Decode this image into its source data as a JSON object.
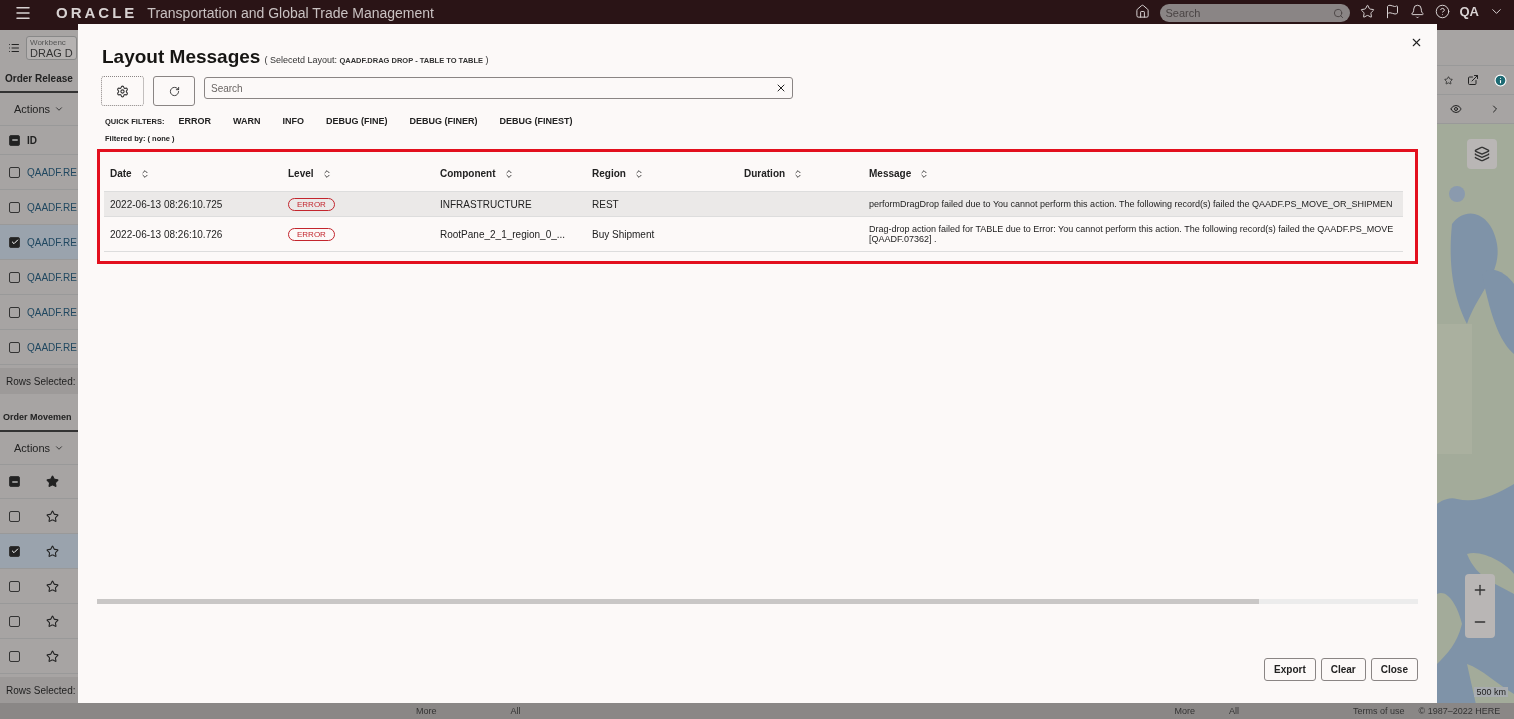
{
  "app_header": {
    "logo": "ORACLE",
    "title": "Transportation and Global Trade Management",
    "search": {
      "placeholder": "Search"
    },
    "user": "QA"
  },
  "left_panel": {
    "workbench": {
      "label": "Workbenc",
      "value": "DRAG D"
    },
    "order_release": {
      "tab": "Order Release",
      "actions": "Actions",
      "column": "ID",
      "select_all_partial": true,
      "rows": [
        {
          "id": "QAADF.RE",
          "checked": false
        },
        {
          "id": "QAADF.RE",
          "checked": false
        },
        {
          "id": "QAADF.RE",
          "checked": true
        },
        {
          "id": "QAADF.RE",
          "checked": false
        },
        {
          "id": "QAADF.RE",
          "checked": false
        },
        {
          "id": "QAADF.RE",
          "checked": false
        }
      ],
      "rows_selected": "Rows Selected:"
    },
    "order_movement": {
      "tab": "Order Movemen",
      "actions": "Actions",
      "select_all_partial": true,
      "header_starred": true,
      "rows": [
        {
          "checked": false,
          "starred": false
        },
        {
          "checked": true,
          "starred": false
        },
        {
          "checked": false,
          "starred": false
        },
        {
          "checked": false,
          "starred": false
        },
        {
          "checked": false,
          "starred": false
        }
      ],
      "rows_selected": "Rows Selected:"
    }
  },
  "map_panel": {
    "scale": "500 km",
    "copyright": "© 1987–2022 HERE",
    "terms": "Terms of use"
  },
  "footer_links": [
    "More",
    "All",
    "More",
    "All"
  ],
  "dialog": {
    "title": "Layout Messages",
    "subtitle_prefix": "( Selecetd Layout: ",
    "layout_name": "QAADF.DRAG DROP - TABLE TO TABLE",
    "subtitle_suffix": " )",
    "search": {
      "placeholder": "Search"
    },
    "quick_filters_label": "QUICK FILTERS:",
    "quick_filters": [
      "ERROR",
      "WARN",
      "INFO",
      "DEBUG (FINE)",
      "DEBUG (FINER)",
      "DEBUG (FINEST)"
    ],
    "filtered_by": "Filtered by: ( none )",
    "table": {
      "columns": [
        "Date",
        "Level",
        "Component",
        "Region",
        "Duration",
        "Message"
      ],
      "rows": [
        {
          "date": "2022-06-13 08:26:10.725",
          "level": "ERROR",
          "component": "INFRASTRUCTURE",
          "region": "REST",
          "message_lines": [
            "performDragDrop failed due to You cannot perform this action. The following record(s) failed the QAADF.PS_MOVE_OR_SHIPMEN"
          ],
          "selected": true
        },
        {
          "date": "2022-06-13 08:26:10.726",
          "level": "ERROR",
          "component": "RootPane_2_1_region_0_...",
          "region": "Buy Shipment",
          "message_lines": [
            "Drag-drop action failed for TABLE due to Error: You cannot perform this action. The following record(s) failed the QAADF.PS_MOVE",
            "[QAADF.07362] ."
          ],
          "selected": false
        }
      ]
    },
    "buttons": [
      "Export",
      "Clear",
      "Close"
    ]
  }
}
